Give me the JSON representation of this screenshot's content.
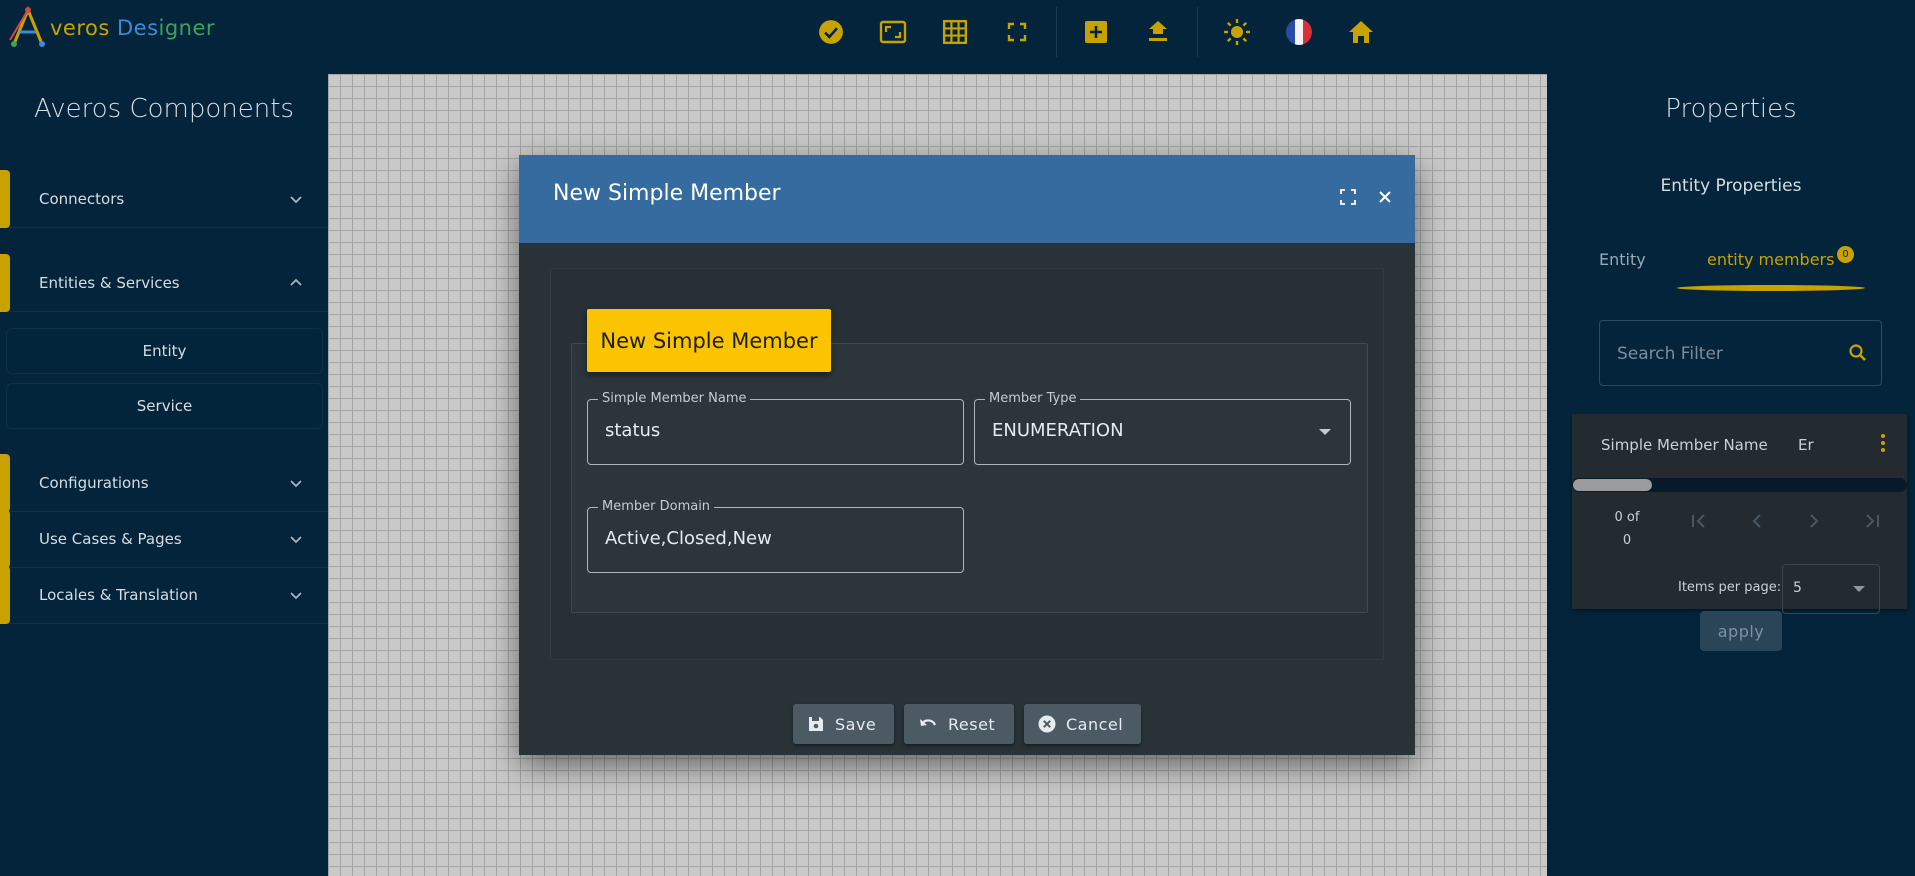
{
  "app": {
    "logo_parts": [
      "A",
      "veros ",
      "Des",
      "igner"
    ]
  },
  "toolbar": {
    "items": [
      "check-circle-icon",
      "fit-screen-icon",
      "grid-icon",
      "fullscreen-icon",
      "add-box-icon",
      "upload-icon",
      "brightness-icon",
      "french-flag-icon",
      "home-icon"
    ]
  },
  "sidebar": {
    "title": "Averos Components",
    "groups": [
      {
        "label": "Connectors",
        "expanded": false
      },
      {
        "label": "Entities & Services",
        "expanded": true,
        "items": [
          "Entity",
          "Service"
        ]
      },
      {
        "label": "Configurations",
        "expanded": false
      },
      {
        "label": "Use Cases & Pages",
        "expanded": false
      },
      {
        "label": "Locales & Translation",
        "expanded": false
      }
    ]
  },
  "properties": {
    "title": "Properties",
    "subtitle": "Entity Properties",
    "tabs": [
      {
        "label": "Entity",
        "active": false
      },
      {
        "label": "entity members",
        "active": true,
        "badge": "0"
      }
    ],
    "search_placeholder": "Search Filter",
    "table": {
      "columns": [
        "Simple Member Name",
        "Er"
      ],
      "range_top": "0 of",
      "range_bottom": "0",
      "items_per_page_label": "Items per page:",
      "items_per_page": "5"
    },
    "apply_label": "apply"
  },
  "dialog": {
    "title": "New Simple Member",
    "section_title": "New Simple Member",
    "fields": {
      "name": {
        "label": "Simple Member Name",
        "value": "status"
      },
      "type": {
        "label": "Member Type",
        "value": "ENUMERATION"
      },
      "domain": {
        "label": "Member Domain",
        "value": "Active,Closed,New"
      }
    },
    "buttons": {
      "save": "Save",
      "reset": "Reset",
      "cancel": "Cancel"
    }
  },
  "colors": {
    "background": "#03243a",
    "accent": "#c7a200",
    "dialog_header": "#356b9e",
    "legend": "#fbc400"
  }
}
